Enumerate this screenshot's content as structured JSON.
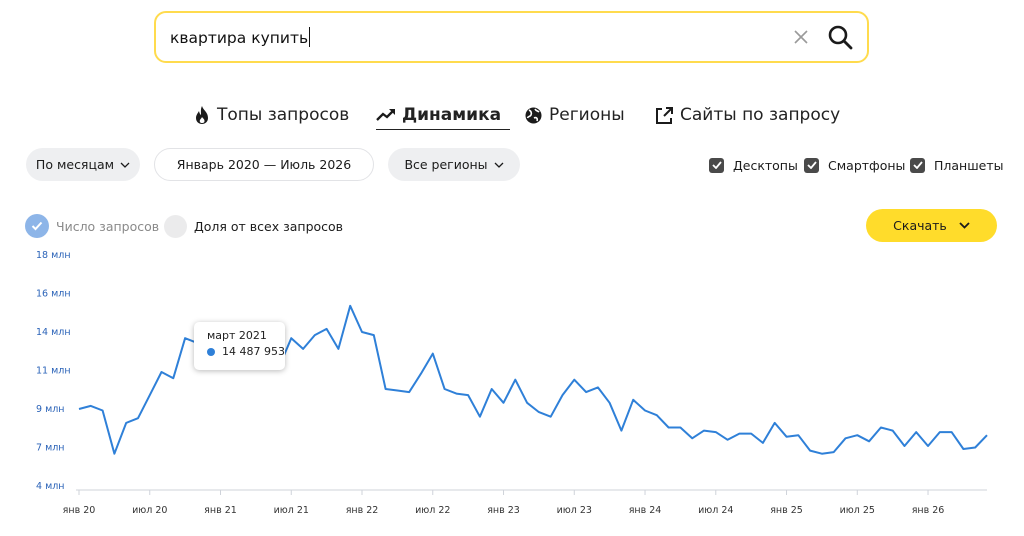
{
  "search": {
    "query": "квартира купить"
  },
  "tabs": [
    {
      "label": "Топы запросов",
      "icon": "fire-icon",
      "active": false
    },
    {
      "label": "Динамика",
      "icon": "trend-up-icon",
      "active": true
    },
    {
      "label": "Регионы",
      "icon": "globe-icon",
      "active": false
    },
    {
      "label": "Сайты по запросу",
      "icon": "external-link-icon",
      "active": false
    }
  ],
  "filters": {
    "period_group": "По месяцам",
    "date_range": "Январь 2020 — Июль 2026",
    "regions": "Все регионы"
  },
  "devices": [
    {
      "label": "Десктопы",
      "checked": true
    },
    {
      "label": "Смартфоны",
      "checked": true
    },
    {
      "label": "Планшеты",
      "checked": true
    }
  ],
  "metrics": [
    {
      "label": "Число запросов",
      "selected": true
    },
    {
      "label": "Доля от всех запросов",
      "selected": false
    }
  ],
  "download": {
    "label": "Скачать"
  },
  "tooltip": {
    "date": "март 2021",
    "value": "14 487 953"
  },
  "colors": {
    "accent_yellow": "#ffdc2b",
    "line_blue": "#2f80d8",
    "axis_label_blue": "#2b63b8"
  },
  "chart_data": {
    "type": "line",
    "y_ticks": [
      "4 млн",
      "7 млн",
      "9 млн",
      "11 млн",
      "14 млн",
      "16 млн",
      "18 млн"
    ],
    "y_tick_values": [
      4,
      6.5,
      9,
      11.5,
      14,
      16.5,
      19
    ],
    "x_ticks": [
      "янв 20",
      "июл 20",
      "янв 21",
      "июл 21",
      "янв 22",
      "июл 22",
      "янв 23",
      "июл 23",
      "янв 24",
      "июл 24",
      "янв 25",
      "июл 25",
      "янв 26"
    ],
    "x_tick_indices": [
      0,
      6,
      12,
      18,
      24,
      30,
      36,
      42,
      48,
      54,
      60,
      66,
      72
    ],
    "ylim": [
      4,
      19
    ],
    "series": [
      {
        "values": [
          9.0,
          9.2,
          8.9,
          6.1,
          8.1,
          8.4,
          9.9,
          11.4,
          11.0,
          13.6,
          13.3,
          13.0,
          14.5,
          12.5,
          12.7,
          12.6,
          11.9,
          11.8,
          13.6,
          12.9,
          13.8,
          14.2,
          12.9,
          15.7,
          14.0,
          13.8,
          10.3,
          10.2,
          10.1,
          11.3,
          12.6,
          10.3,
          10.0,
          9.9,
          8.5,
          10.3,
          9.4,
          10.9,
          9.4,
          8.8,
          8.5,
          9.9,
          10.9,
          10.1,
          10.4,
          9.4,
          7.6,
          9.6,
          8.9,
          8.6,
          7.8,
          7.8,
          7.1,
          7.6,
          7.5,
          7.0,
          7.4,
          7.4,
          6.8,
          8.1,
          7.2,
          7.3,
          6.3,
          6.1,
          6.2,
          7.1,
          7.3,
          6.9,
          7.8,
          7.6,
          6.6,
          7.5,
          6.6,
          7.5,
          7.5,
          6.4,
          6.5,
          7.3
        ]
      }
    ]
  }
}
